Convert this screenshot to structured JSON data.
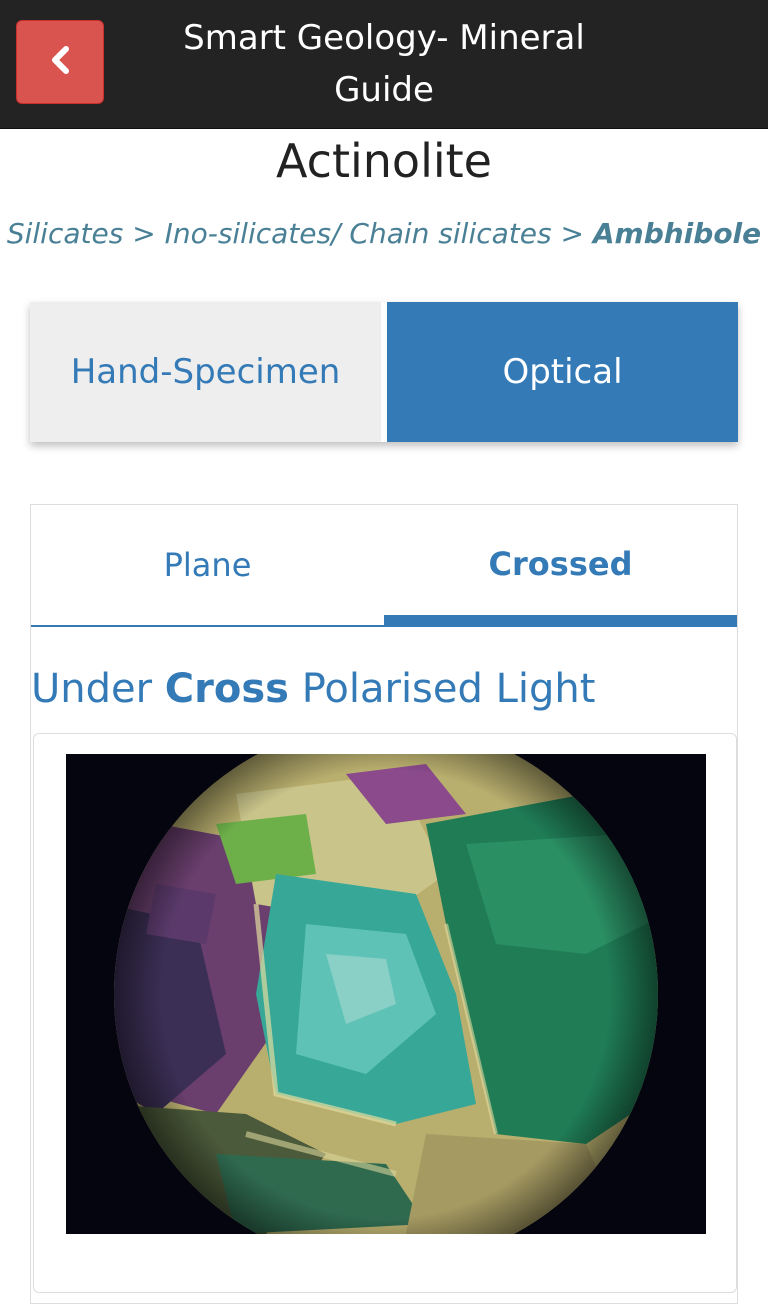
{
  "header": {
    "title": "Smart Geology- Mineral Guide",
    "back_icon": "chevron-left-icon"
  },
  "mineral": {
    "name": "Actinolite",
    "breadcrumb": {
      "part1": "Silicates",
      "sep": ">",
      "part2": "Ino-silicates/ Chain silicates",
      "part3": "Ambhibole"
    }
  },
  "main_tabs": {
    "hand_specimen": "Hand-Specimen",
    "optical": "Optical",
    "active": "Optical"
  },
  "sub_tabs": {
    "plane": "Plane",
    "crossed": "Crossed",
    "active": "Crossed"
  },
  "section": {
    "prefix": "Under",
    "emphasis": "Cross",
    "suffix": "Polarised Light"
  },
  "colors": {
    "header_bg": "#232323",
    "back_button": "#d9534f",
    "accent": "#337ab7",
    "breadcrumb": "#4a8096"
  }
}
